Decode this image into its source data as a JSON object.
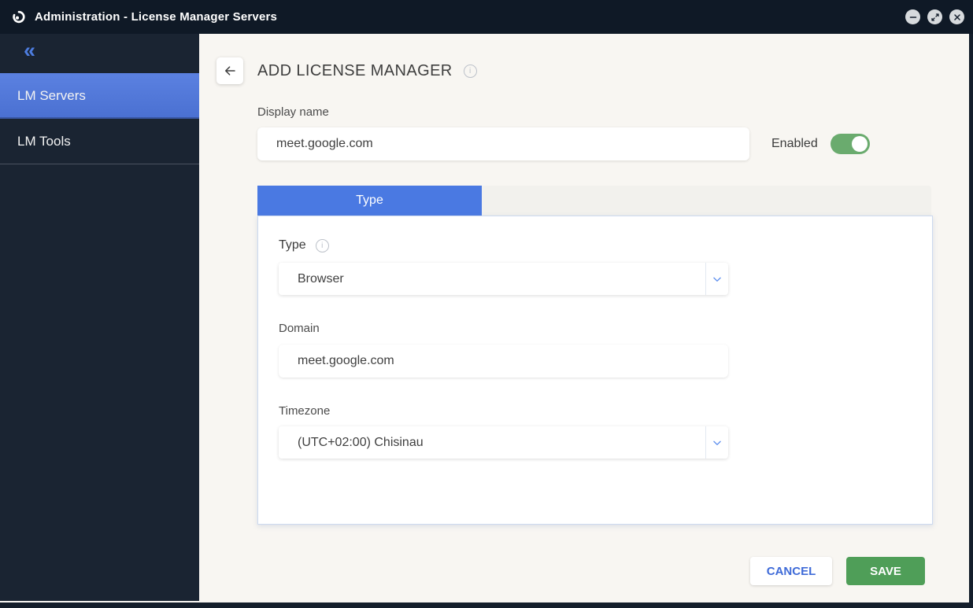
{
  "window": {
    "title": "Administration - License Manager Servers",
    "controls": {
      "minimize": "minimize",
      "maximize": "maximize",
      "close": "close"
    }
  },
  "icons": {
    "collapse_glyph": "«",
    "info_glyph": "i"
  },
  "sidebar": {
    "items": [
      {
        "label": "LM Servers",
        "selected": true
      },
      {
        "label": "LM Tools",
        "selected": false
      }
    ]
  },
  "main": {
    "title": "ADD LICENSE MANAGER",
    "display_name": {
      "label": "Display name",
      "value": "meet.google.com"
    },
    "enabled": {
      "label": "Enabled",
      "state": "on"
    },
    "tabs": [
      {
        "label": "Type",
        "active": true
      }
    ],
    "form": {
      "type": {
        "label": "Type",
        "value": "Browser"
      },
      "domain": {
        "label": "Domain",
        "value": "meet.google.com"
      },
      "timezone": {
        "label": "Timezone",
        "value": "(UTC+02:00) Chisinau"
      }
    },
    "actions": {
      "cancel": "CANCEL",
      "save": "SAVE"
    }
  },
  "colors": {
    "titlebar": "#0f1926",
    "sidebar": "#1a2432",
    "selected_item_blue": "#5277d9",
    "accent_blue": "#4a79e2",
    "toggle_green": "#6aab6e",
    "save_green": "#4f9e58",
    "cancel_text_blue": "#3f6bd8",
    "main_bg": "#f8f6f2"
  }
}
